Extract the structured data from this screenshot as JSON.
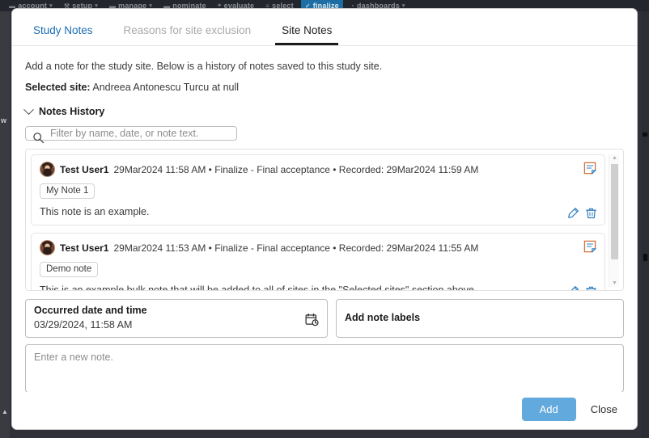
{
  "app_navbar": {
    "items": [
      {
        "label": "account",
        "icon": "briefcase-icon",
        "has_caret": true,
        "active": false
      },
      {
        "label": "setup",
        "icon": "wrench-icon",
        "has_caret": true,
        "active": false
      },
      {
        "label": "manage",
        "icon": "folder-icon",
        "has_caret": true,
        "active": false
      },
      {
        "label": "nominate",
        "icon": "card-icon",
        "has_caret": false,
        "active": false
      },
      {
        "label": "evaluate",
        "icon": "compass-icon",
        "has_caret": false,
        "active": false
      },
      {
        "label": "select",
        "icon": "list-icon",
        "has_caret": false,
        "active": false
      },
      {
        "label": "finalize",
        "icon": "check-icon",
        "has_caret": false,
        "active": true
      },
      {
        "label": "dashboards",
        "icon": "gauge-icon",
        "has_caret": true,
        "active": false
      }
    ]
  },
  "left_rail": {
    "letter": "w",
    "arrow": "▲"
  },
  "tabs": [
    {
      "label": "Study Notes",
      "state": "link"
    },
    {
      "label": "Reasons for site exclusion",
      "state": "disabled"
    },
    {
      "label": "Site Notes",
      "state": "active"
    }
  ],
  "content": {
    "intro": "Add a note for the study site. Below is a history of notes saved to this study site.",
    "selected_site_label": "Selected site:",
    "selected_site_value": "Andreea Antonescu Turcu at null",
    "notes_history_title": "Notes History"
  },
  "filter": {
    "placeholder": "Filter by name, date, or note text.",
    "value": ""
  },
  "notes": [
    {
      "user": "Test User1",
      "meta": "29Mar2024 11:58 AM • Finalize - Final acceptance • Recorded: 29Mar2024 11:59 AM",
      "label": "My Note 1",
      "text": "This note is an example."
    },
    {
      "user": "Test User1",
      "meta": "29Mar2024 11:53 AM • Finalize - Final acceptance • Recorded: 29Mar2024 11:55 AM",
      "label": "Demo note",
      "text": "This is an example bulk note that will be added to all of sites in the \"Selected sites\" section above."
    }
  ],
  "form": {
    "date_label": "Occurred date and time",
    "date_value": "03/29/2024, 11:58 AM",
    "labels_placeholder": "Add note labels",
    "labels_value": "",
    "note_placeholder": "Enter a new note.",
    "note_value": ""
  },
  "footer": {
    "add_label": "Add",
    "close_label": "Close"
  },
  "colors": {
    "accent_button": "#62a9dd",
    "tab_link": "#1a6cb5",
    "tab_active": "#1b1b1b",
    "icon_blue": "#2f7fc1",
    "icon_orange": "#d0703a",
    "navbar_bg": "#24262e",
    "navbar_active": "#1c6ea4"
  }
}
